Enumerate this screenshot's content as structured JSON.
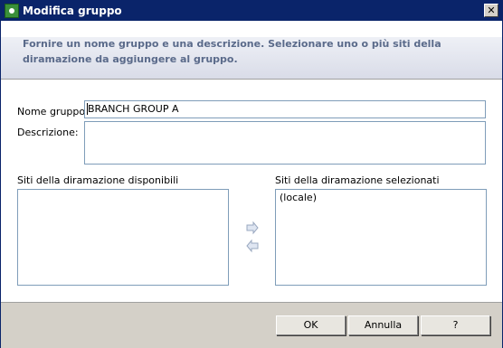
{
  "window": {
    "title": "Modifica gruppo",
    "close_label": "✕"
  },
  "header": {
    "text": "Fornire un nome gruppo e una descrizione. Selezionare uno o più siti della diramazione da aggiungere al gruppo."
  },
  "form": {
    "group_name_label": "Nome gruppo:",
    "group_name_value": "BRANCH GROUP A",
    "description_label": "Descrizione:",
    "description_value": ""
  },
  "lists": {
    "available_label": "Siti della diramazione disponibili",
    "available_items": [],
    "selected_label": "Siti della diramazione selezionati",
    "selected_items": [
      "(locale)"
    ]
  },
  "buttons": {
    "ok": "OK",
    "cancel": "Annulla",
    "help": "?"
  },
  "icons": {
    "app": "app-icon",
    "add": "arrow-right-icon",
    "remove": "arrow-left-icon"
  }
}
